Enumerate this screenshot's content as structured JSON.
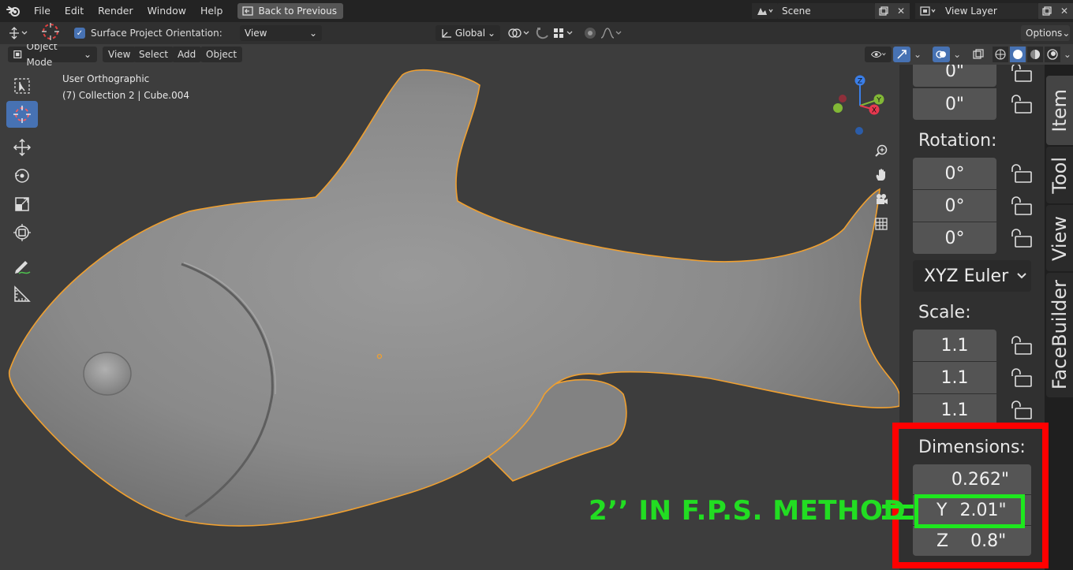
{
  "menu": {
    "items": [
      "File",
      "Edit",
      "Render",
      "Window",
      "Help"
    ],
    "back_button": "Back to Previous",
    "scene": "Scene",
    "view_layer": "View Layer"
  },
  "tool_settings": {
    "surface_project": "Surface Project",
    "orientation_label": "Orientation:",
    "orientation_value": "View",
    "transform_orientation": "Global",
    "options": "Options"
  },
  "header": {
    "mode": "Object Mode",
    "view": "View",
    "select": "Select",
    "add": "Add",
    "object": "Object"
  },
  "viewport": {
    "view_name": "User Orthographic",
    "collection_info": "(7) Collection 2 | Cube.004"
  },
  "gizmo": {
    "x": "X",
    "y": "Y",
    "z": "Z"
  },
  "npanel": {
    "location_y": "0\"",
    "location_z": "0\"",
    "rotation_label": "Rotation:",
    "rotation": [
      "0°",
      "0°",
      "0°"
    ],
    "rotation_mode": "XYZ Euler",
    "scale_label": "Scale:",
    "scale": [
      "1.1",
      "1.1",
      "1.1"
    ],
    "dimensions_label": "Dimensions:",
    "dim_x": "0.262\"",
    "dim_y_axis": "Y",
    "dim_y": "2.01\"",
    "dim_z_axis": "Z",
    "dim_z": "0.8\""
  },
  "tabs": [
    "Item",
    "Tool",
    "View",
    "FaceBuilder"
  ],
  "annotation": "2’’ IN F.P.S. METHOD",
  "colors": {
    "selection_outline": "#f0a030",
    "active_tool": "#4772b3",
    "highlight_red": "#ff0000",
    "highlight_green": "#1ee81e"
  }
}
